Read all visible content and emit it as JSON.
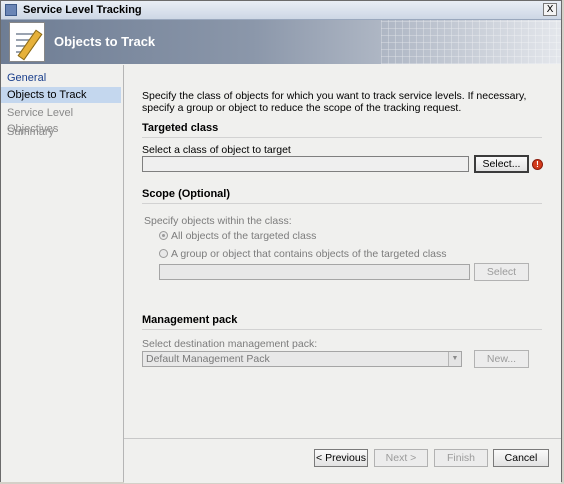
{
  "window": {
    "title": "Service Level Tracking",
    "close_glyph": "X"
  },
  "banner": {
    "title": "Objects to Track",
    "icon": "notepad-pen-icon"
  },
  "nav": {
    "items": [
      {
        "label": "General",
        "state": "active"
      },
      {
        "label": "Objects to Track",
        "state": "selected"
      },
      {
        "label": "Service Level Objectives",
        "state": "disabled"
      },
      {
        "label": "Summary",
        "state": "disabled"
      }
    ]
  },
  "main": {
    "description": "Specify the class of objects for which you want to track service levels. If necessary, specify a group or object to reduce the scope of the tracking request.",
    "targeted_class": {
      "header": "Targeted class",
      "label": "Select a class of object to target",
      "value": "",
      "select_button": "Select...",
      "warning_icon": "error-icon"
    },
    "scope": {
      "header": "Scope (Optional)",
      "label": "Specify objects within the class:",
      "option_all": "All objects of the targeted class",
      "option_group": "A group or object that contains objects of the targeted class",
      "selected_option": "all",
      "value": "",
      "select_button": "Select"
    },
    "management_pack": {
      "header": "Management pack",
      "label": "Select destination management pack:",
      "selected": "Default Management Pack",
      "new_button": "New..."
    }
  },
  "footer": {
    "previous": "< Previous",
    "next": "Next >",
    "finish": "Finish",
    "cancel": "Cancel"
  }
}
